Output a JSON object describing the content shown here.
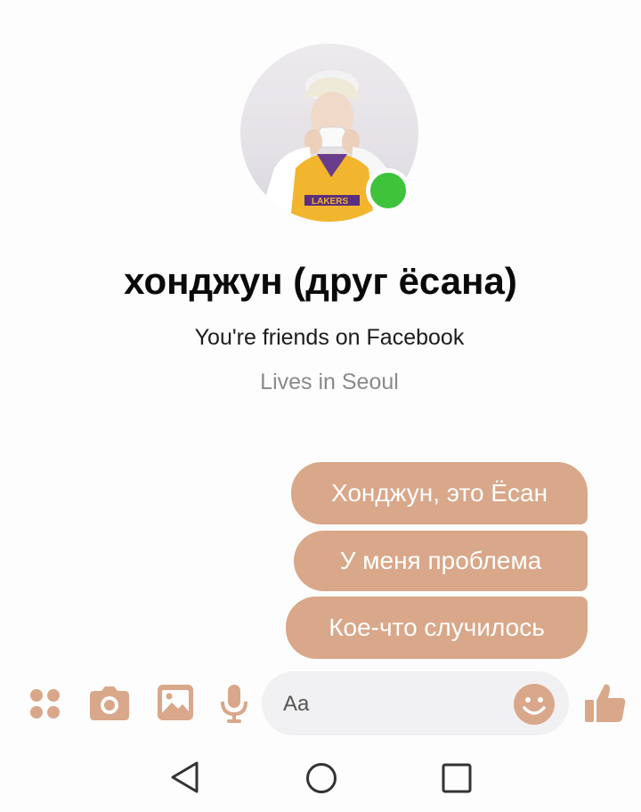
{
  "profile": {
    "name": "хонджун (друг ёсана)",
    "friends_text": "You're friends on Facebook",
    "location_text": "Lives in Seoul",
    "online": true
  },
  "messages": [
    {
      "text": "Хонджун, это Ёсан"
    },
    {
      "text": "У меня проблема"
    },
    {
      "text": "Кое-что случилось"
    }
  ],
  "composer": {
    "placeholder": "Aa",
    "icons": [
      "apps-icon",
      "camera-icon",
      "gallery-icon",
      "microphone-icon",
      "emoji-icon",
      "thumbs-up-icon"
    ]
  },
  "navigation": {
    "buttons": [
      "back-icon",
      "home-icon",
      "recents-icon"
    ]
  },
  "colors": {
    "bubble": "#d9a789",
    "accent": "#d9a789",
    "online": "#3ec33b",
    "input_bg": "#f1f1f3"
  }
}
